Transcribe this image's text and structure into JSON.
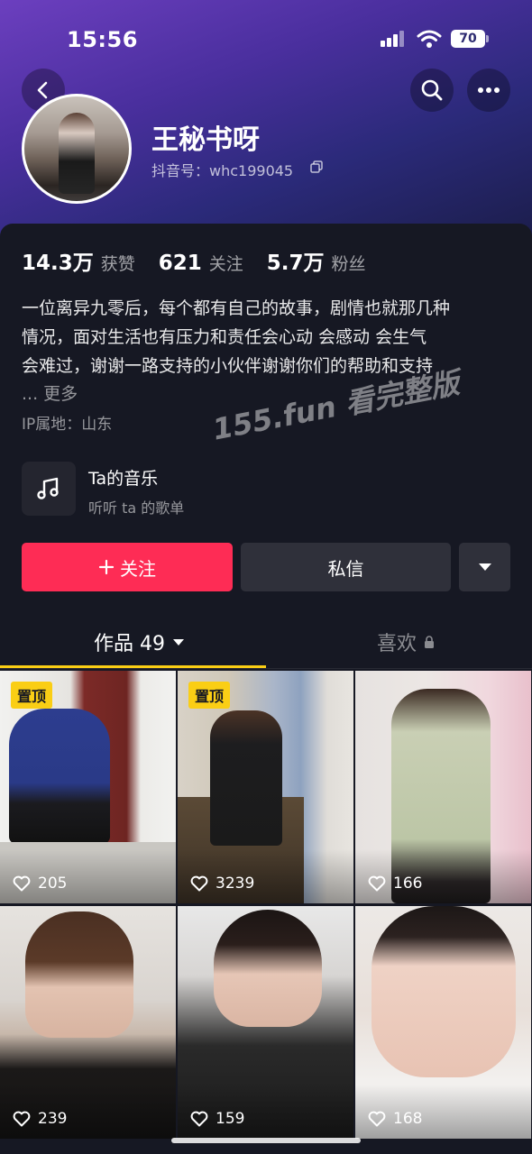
{
  "status_bar": {
    "time": "15:56",
    "battery": "70"
  },
  "profile": {
    "nickname": "王秘书呀",
    "douyin_id": "抖音号：whc199045"
  },
  "stats": [
    {
      "value": "14.3万",
      "label": "获赞"
    },
    {
      "value": "621",
      "label": "关注"
    },
    {
      "value": "5.7万",
      "label": "粉丝"
    }
  ],
  "bio": {
    "line1": "一位离异九零后，每个都有自己的故事，剧情也就那几种",
    "line2": "情况，面对生活也有压力和责任会心动 会感动  会生气",
    "line3": "会难过，谢谢一路支持的小伙伴谢谢你们的帮助和支持",
    "more": "... 更多"
  },
  "ip_location": "IP属地：山东",
  "watermark": "155.fun 看完整版",
  "music": {
    "title": "Ta的音乐",
    "subtitle": "听听 ta 的歌单",
    "icon": "music-note-icon"
  },
  "buttons": {
    "follow": "关注",
    "message": "私信"
  },
  "tabs": {
    "works": "作品 49",
    "likes": "喜欢"
  },
  "videos": [
    {
      "likes": "205",
      "pinned": "置顶"
    },
    {
      "likes": "3239",
      "pinned": "置顶"
    },
    {
      "likes": "166"
    },
    {
      "likes": "239"
    },
    {
      "likes": "159"
    },
    {
      "likes": "168"
    }
  ],
  "colors": {
    "accent": "#fe2c55",
    "tab_indicator": "#face15",
    "background": "#161823"
  }
}
